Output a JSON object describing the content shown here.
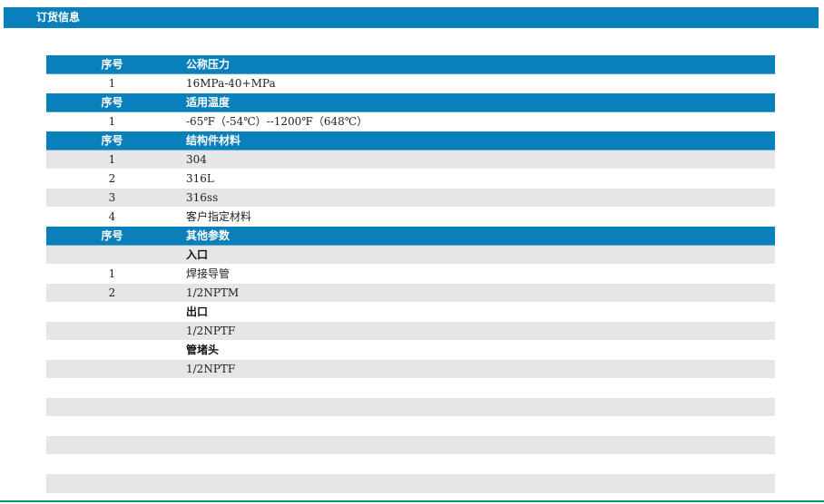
{
  "page_title": "订货信息",
  "sections": [
    {
      "header": {
        "no": "序号",
        "label": "公称压力"
      },
      "rows": [
        {
          "no": "1",
          "value": "16MPa-40+MPa"
        }
      ]
    },
    {
      "header": {
        "no": "序号",
        "label": "适用温度"
      },
      "rows": [
        {
          "no": "1",
          "value": "-65℉（-54℃）--1200℉（648℃）"
        }
      ]
    },
    {
      "header": {
        "no": "序号",
        "label": "结构件材料"
      },
      "rows": [
        {
          "no": "1",
          "value": "304"
        },
        {
          "no": "2",
          "value": "316L"
        },
        {
          "no": "3",
          "value": "316ss"
        },
        {
          "no": "4",
          "value": "客户指定材料"
        }
      ]
    },
    {
      "header": {
        "no": "序号",
        "label": "其他参数"
      },
      "rows": [
        {
          "no": "",
          "value": "入口",
          "subheading": true
        },
        {
          "no": "1",
          "value": "焊接导管"
        },
        {
          "no": "2",
          "value": "1/2NPTM"
        },
        {
          "no": "",
          "value": "出口",
          "subheading": true
        },
        {
          "no": "",
          "value": "1/2NPTF"
        },
        {
          "no": "",
          "value": "管堵头",
          "subheading": true
        },
        {
          "no": "",
          "value": "1/2NPTF"
        },
        {
          "no": "",
          "value": ""
        },
        {
          "no": "",
          "value": ""
        },
        {
          "no": "",
          "value": ""
        },
        {
          "no": "",
          "value": ""
        },
        {
          "no": "",
          "value": ""
        },
        {
          "no": "",
          "value": ""
        }
      ]
    }
  ]
}
